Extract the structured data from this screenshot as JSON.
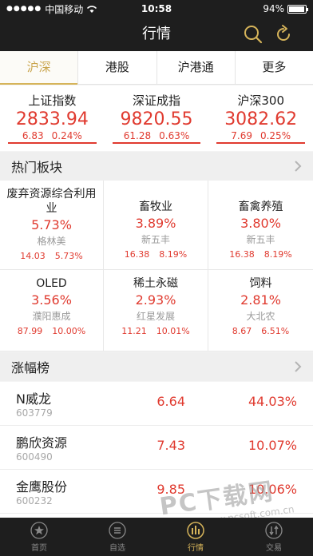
{
  "status_bar": {
    "carrier": "中国移动",
    "time": "10:58",
    "battery": "94%",
    "battery_level": 0.94
  },
  "header": {
    "title": "行情",
    "icons": [
      "search-icon",
      "refresh-icon"
    ]
  },
  "tabs": [
    {
      "label": "沪深",
      "active": true
    },
    {
      "label": "港股",
      "active": false
    },
    {
      "label": "沪港通",
      "active": false
    },
    {
      "label": "更多",
      "active": false
    }
  ],
  "indices": [
    {
      "name": "上证指数",
      "value": "2833.94",
      "change": "6.83",
      "pct": "0.24%"
    },
    {
      "name": "深证成指",
      "value": "9820.55",
      "change": "61.28",
      "pct": "0.63%"
    },
    {
      "name": "沪深300",
      "value": "3082.62",
      "change": "7.69",
      "pct": "0.25%"
    }
  ],
  "hot_sectors": {
    "title": "热门板块",
    "items": [
      {
        "name": "废弃资源综合利用业",
        "pct": "5.73%",
        "stock": "格林美",
        "price": "14.03",
        "stock_pct": "5.73%"
      },
      {
        "name": "畜牧业",
        "pct": "3.89%",
        "stock": "新五丰",
        "price": "16.38",
        "stock_pct": "8.19%"
      },
      {
        "name": "畜禽养殖",
        "pct": "3.80%",
        "stock": "新五丰",
        "price": "16.38",
        "stock_pct": "8.19%"
      },
      {
        "name": "OLED",
        "pct": "3.56%",
        "stock": "濮阳惠成",
        "price": "87.99",
        "stock_pct": "10.00%"
      },
      {
        "name": "稀土永磁",
        "pct": "2.93%",
        "stock": "红星发展",
        "price": "11.21",
        "stock_pct": "10.01%"
      },
      {
        "name": "饲料",
        "pct": "2.81%",
        "stock": "大北农",
        "price": "8.67",
        "stock_pct": "6.51%"
      }
    ]
  },
  "gainers": {
    "title": "涨幅榜",
    "rows": [
      {
        "name": "N威龙",
        "code": "603779",
        "price": "6.64",
        "pct": "44.03%"
      },
      {
        "name": "鹏欣资源",
        "code": "600490",
        "price": "7.43",
        "pct": "10.07%"
      },
      {
        "name": "金鹰股份",
        "code": "600232",
        "price": "9.85",
        "pct": "10.06%"
      }
    ]
  },
  "bottom_tabs": [
    {
      "label": "首页",
      "icon": "star-icon",
      "active": false
    },
    {
      "label": "自选",
      "icon": "list-icon",
      "active": false
    },
    {
      "label": "行情",
      "icon": "market-icon",
      "active": true
    },
    {
      "label": "交易",
      "icon": "trade-icon",
      "active": false
    }
  ],
  "watermark": {
    "text": "PC下载网",
    "url": "www.pcsoft.com.cn"
  },
  "colors": {
    "up": "#e03a2f",
    "accent": "#d6b45a",
    "dark_bar": "#1e1e1e"
  }
}
